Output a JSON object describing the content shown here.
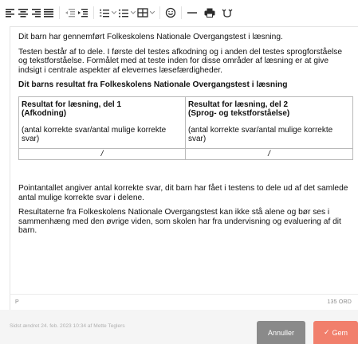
{
  "editor": {
    "intro": "Dit barn har gennemført Folkeskolens Nationale Overgangstest i læsning.",
    "description": "Testen består af to dele. I første del testes afkodning og i anden del testes sprogforståelse og tekstforståelse. Formålet med at teste inden for disse områder af læsning er at give indsigt i centrale aspekter af elevernes læsefærdigheder.",
    "heading": "Dit barns resultat fra Folkeskolens Nationale Overgangstest i læsning",
    "table": {
      "col1_title": "Resultat for læsning, del 1",
      "col1_sub": "(Afkodning)",
      "col1_note": "(antal korrekte svar/antal mulige korrekte svar)",
      "col2_title": "Resultat for læsning, del 2",
      "col2_sub": "(Sprog- og tekstforståelse)",
      "col2_note": "(antal korrekte svar/antal mulige korrekte svar)",
      "col1_value": "/",
      "col2_value": "/"
    },
    "points_text": "Pointantallet angiver antal korrekte svar, dit barn har fået i testens to dele ud af det samlede antal mulige korrekte svar i delene.",
    "results_text": "Resultaterne fra Folkeskolens Nationale Overgangstest kan ikke stå alene og bør ses i sammenhæng med den øvrige viden, som skolen har fra undervisning og evaluering af dit barn."
  },
  "statusbar": {
    "path": "P",
    "word_count": "135 ORD"
  },
  "footer": {
    "modified": "Sidst ændret 24. feb. 2023 10:34 af Mette Teglers",
    "cancel_label": "Annuller",
    "save_label": "Gem",
    "save_icon": "✓"
  },
  "colors": {
    "save": "#f17f6c",
    "cancel": "#8a8a8a"
  }
}
